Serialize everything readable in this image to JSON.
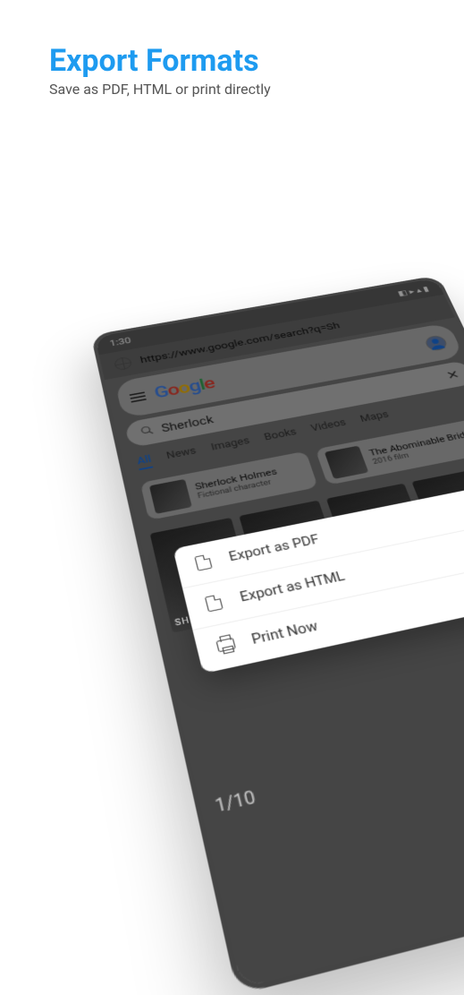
{
  "hero": {
    "title": "Export Formats",
    "subtitle": "Save as PDF, HTML or print directly"
  },
  "phone": {
    "status_time": "1:30",
    "url": "https://www.google.com/search?q=Sh",
    "logo_letters": [
      "G",
      "o",
      "o",
      "g",
      "l",
      "e"
    ],
    "search_query": "Sherlock",
    "tabs": [
      "All",
      "News",
      "Images",
      "Books",
      "Videos",
      "Maps"
    ],
    "cards": [
      {
        "title": "Sherlock Holmes",
        "sub": "Fictional character"
      },
      {
        "title": "The Abominable Bride",
        "sub": "2016 film"
      }
    ],
    "poster_label": "SHERLOCK",
    "rating": "1/10"
  },
  "sheet": {
    "items": [
      {
        "icon": "pdf",
        "label": "Export as PDF"
      },
      {
        "icon": "html",
        "label": "Export as HTML"
      },
      {
        "icon": "print",
        "label": "Print Now"
      }
    ]
  }
}
